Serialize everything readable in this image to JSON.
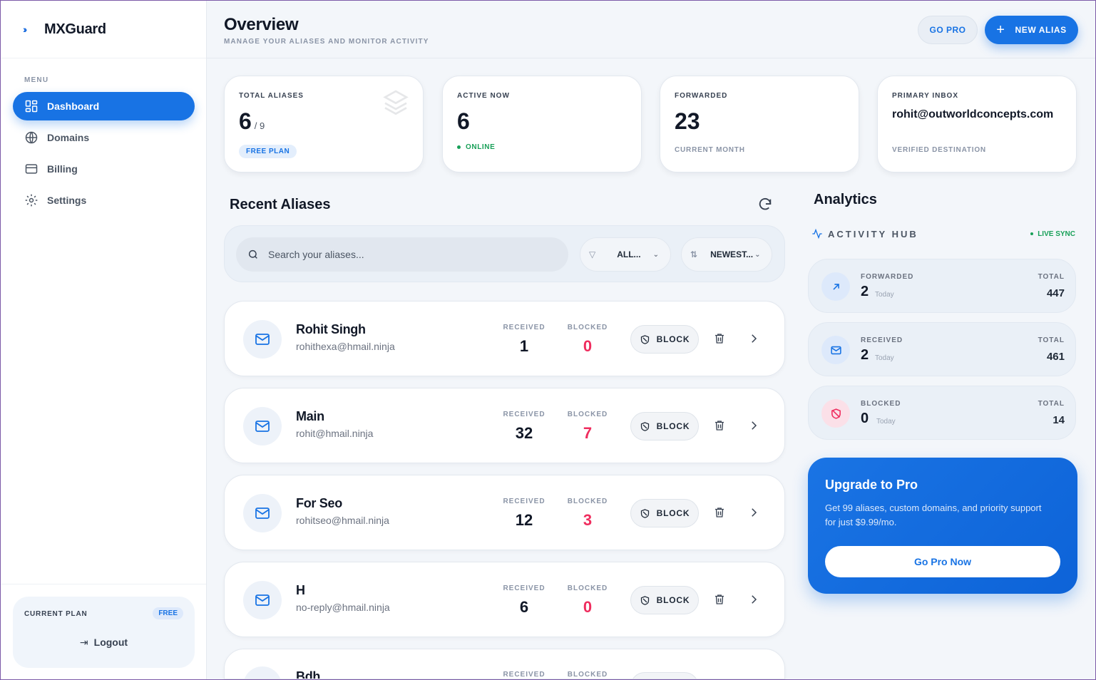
{
  "brand": {
    "name": "MXGuard",
    "icon": "double-chevron-icon"
  },
  "sidebar": {
    "menu_label": "MENU",
    "items": [
      {
        "label": "Dashboard",
        "icon": "grid-icon",
        "active": true
      },
      {
        "label": "Domains",
        "icon": "globe-icon",
        "active": false
      },
      {
        "label": "Billing",
        "icon": "credit-card-icon",
        "active": false
      },
      {
        "label": "Settings",
        "icon": "gear-icon",
        "active": false
      }
    ],
    "plan": {
      "label": "CURRENT PLAN",
      "badge": "FREE",
      "logout": "Logout"
    }
  },
  "header": {
    "title": "Overview",
    "subtitle": "MANAGE YOUR ALIASES AND MONITOR ACTIVITY",
    "go_pro": "GO PRO",
    "new_alias": "NEW ALIAS"
  },
  "stats": {
    "total_aliases": {
      "label": "TOTAL ALIASES",
      "value": "6",
      "of": "/ 9",
      "badge": "FREE PLAN"
    },
    "active_now": {
      "label": "ACTIVE NOW",
      "value": "6",
      "status": "ONLINE"
    },
    "forwarded": {
      "label": "FORWARDED",
      "value": "23",
      "foot": "CURRENT MONTH"
    },
    "primary_inbox": {
      "label": "PRIMARY INBOX",
      "value": "rohit@outworldconcepts.com",
      "foot": "VERIFIED DESTINATION"
    }
  },
  "recent": {
    "title": "Recent Aliases",
    "search_placeholder": "Search your aliases...",
    "filter_value": "ALL...",
    "sort_value": "NEWEST...",
    "received_label": "RECEIVED",
    "blocked_label": "BLOCKED",
    "block_label": "BLOCK",
    "aliases": [
      {
        "name": "Rohit Singh",
        "email": "rohithexa@hmail.ninja",
        "received": "1",
        "blocked": "0"
      },
      {
        "name": "Main",
        "email": "rohit@hmail.ninja",
        "received": "32",
        "blocked": "7"
      },
      {
        "name": "For Seo",
        "email": "rohitseo@hmail.ninja",
        "received": "12",
        "blocked": "3"
      },
      {
        "name": "H",
        "email": "no-reply@hmail.ninja",
        "received": "6",
        "blocked": "0"
      },
      {
        "name": "Bdh",
        "email": "",
        "received": "",
        "blocked": ""
      }
    ]
  },
  "analytics": {
    "title": "Analytics",
    "hub_label": "ACTIVITY HUB",
    "live": "LIVE SYNC",
    "total_label": "TOTAL",
    "today_label": "Today",
    "metrics": [
      {
        "label": "FORWARDED",
        "today": "2",
        "total": "447",
        "icon": "arrow-up-right-icon",
        "color": "#1873e4",
        "bg": "#dde9fb"
      },
      {
        "label": "RECEIVED",
        "today": "2",
        "total": "461",
        "icon": "mail-icon",
        "color": "#1873e4",
        "bg": "#dde9fb"
      },
      {
        "label": "BLOCKED",
        "today": "0",
        "total": "14",
        "icon": "shield-off-icon",
        "color": "#ef2d5e",
        "bg": "#fbe0e8"
      }
    ]
  },
  "upgrade": {
    "title": "Upgrade to Pro",
    "text": "Get 99 aliases, custom domains, and priority support for just $9.99/mo.",
    "button": "Go Pro Now"
  },
  "colors": {
    "accent": "#1873e4",
    "danger": "#ef2d5e",
    "success": "#18a058"
  }
}
